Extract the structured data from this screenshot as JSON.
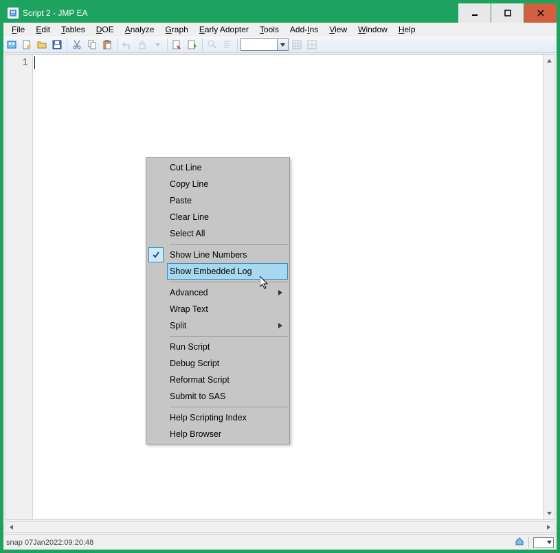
{
  "window": {
    "title": "Script 2 - JMP EA"
  },
  "menubar": {
    "items": [
      "File",
      "Edit",
      "Tables",
      "DOE",
      "Analyze",
      "Graph",
      "Early Adopter",
      "Tools",
      "Add-Ins",
      "View",
      "Window",
      "Help"
    ]
  },
  "editor": {
    "line_number": "1"
  },
  "statusbar": {
    "text": "snap 07Jan2022:09:20:48"
  },
  "context_menu": {
    "items": [
      {
        "label": "Cut Line"
      },
      {
        "label": "Copy Line"
      },
      {
        "label": "Paste"
      },
      {
        "label": "Clear Line"
      },
      {
        "label": "Select All"
      },
      {
        "sep": true
      },
      {
        "label": "Show Line Numbers",
        "checked": true
      },
      {
        "label": "Show Embedded Log",
        "highlight": true
      },
      {
        "sep": true
      },
      {
        "label": "Advanced",
        "submenu": true
      },
      {
        "label": "Wrap Text"
      },
      {
        "label": "Split",
        "submenu": true
      },
      {
        "sep": true
      },
      {
        "label": "Run Script"
      },
      {
        "label": "Debug Script"
      },
      {
        "label": "Reformat Script"
      },
      {
        "label": "Submit to SAS"
      },
      {
        "sep": true
      },
      {
        "label": "Help Scripting Index"
      },
      {
        "label": "Help Browser"
      }
    ]
  }
}
